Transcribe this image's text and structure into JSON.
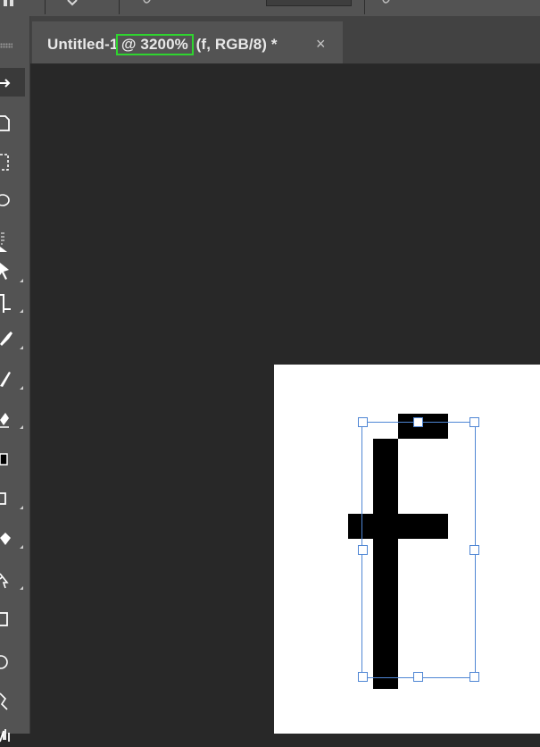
{
  "document_tab": {
    "name": "Untitled-1",
    "zoom": "@ 3200%",
    "mode": "(f, RGB/8) *",
    "close_glyph": "×"
  },
  "toolbar_tools": [
    "move-tool",
    "artboard-tool",
    "rectangular-marquee-tool",
    "lasso-tool",
    "object-selection-tool",
    "crop-tool",
    "eyedropper-tool",
    "spot-healing-brush-tool",
    "brush-tool",
    "clone-stamp-tool",
    "history-brush-tool",
    "eraser-tool",
    "gradient-tool",
    "blur-tool",
    "dodge-tool",
    "pen-tool",
    "type-tool",
    "path-selection-tool",
    "rectangle-tool",
    "ellipse-tool",
    "custom-shape-tool",
    "hand-tool"
  ],
  "colors": {
    "workspace": "#282828",
    "panel": "#535353",
    "zoom_highlight": "#2fd52f",
    "bounding_box": "#4f86d4",
    "glyph": "#000000",
    "canvas": "#ffffff"
  }
}
